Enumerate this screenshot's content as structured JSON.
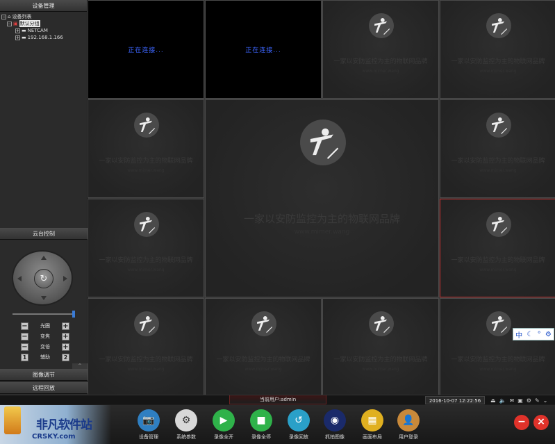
{
  "left_panel": {
    "device_mgmt_title": "设备管理",
    "tree": {
      "root": "设备列表",
      "group": "默认分组",
      "items": [
        "NETCAM",
        "192.168.1.166"
      ]
    },
    "ptz_title": "云台控制",
    "ptz_rows": [
      {
        "label": "光圈",
        "left": "−",
        "right": "+"
      },
      {
        "label": "变焦",
        "left": "−",
        "right": "+"
      },
      {
        "label": "变倍",
        "left": "−",
        "right": "+"
      },
      {
        "label": "辅助",
        "left": "1",
        "right": "2"
      }
    ],
    "image_adjust": "图像调节",
    "remote_playback": "远程回放",
    "collapse_glyph": "«",
    "ptz_collapse_glyph": "^"
  },
  "video": {
    "connecting_text": "正在连接...",
    "watermark": "一家以安防监控为主的物联网品牌",
    "url": "www.mimer.wang"
  },
  "status_bar": {
    "current_user": "当前用户:admin",
    "datetime": "2016-10-07  12:22:56"
  },
  "ime": {
    "lang": "中",
    "moon": "☾",
    "dot": "°",
    "gear": "⚙"
  },
  "toolbar": {
    "brand_title": "非凡软件站",
    "brand_sub": "CRSKY.com",
    "buttons": [
      {
        "label": "设备管理",
        "icon": "camera-icon",
        "color": "#2f7fc1"
      },
      {
        "label": "系统参数",
        "icon": "gear-icon",
        "color": "#d8d8d8"
      },
      {
        "label": "录像全开",
        "icon": "record-on-icon",
        "color": "#2fb24a"
      },
      {
        "label": "录像全停",
        "icon": "record-off-icon",
        "color": "#2fb24a"
      },
      {
        "label": "录像回放",
        "icon": "playback-icon",
        "color": "#2aa0c8"
      },
      {
        "label": "抓拍图像",
        "icon": "snapshot-icon",
        "color": "#1a2a6a"
      },
      {
        "label": "画面布局",
        "icon": "layout-icon",
        "color": "#e0b020"
      },
      {
        "label": "用户登录",
        "icon": "user-icon",
        "color": "#c8893a"
      }
    ],
    "minimize": "−",
    "close": "×"
  }
}
